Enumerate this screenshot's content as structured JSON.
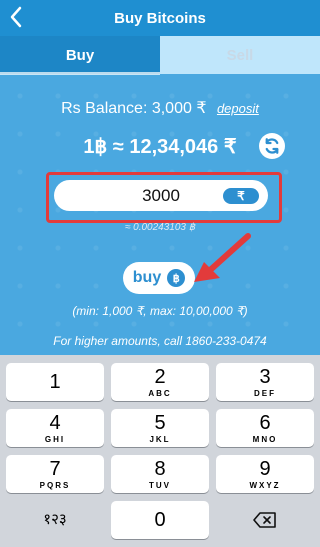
{
  "header": {
    "title": "Buy Bitcoins"
  },
  "tabs": [
    {
      "label": "Buy"
    },
    {
      "label": "Sell"
    }
  ],
  "balance": {
    "text": "Rs Balance: 3,000 ₹",
    "deposit_label": "deposit"
  },
  "rate": {
    "text": "1฿ ≈ 12,34,046 ₹"
  },
  "amount_input": {
    "value": "3000",
    "currency_label": "₹"
  },
  "btc_equivalent": "≈ 0.00243103 ฿",
  "buy_button": {
    "label": "buy",
    "icon_label": "฿"
  },
  "limits_text": "(min: 1,000 ₹, max: 10,00,000 ₹)",
  "higher_amounts_text": "For higher amounts, call 1860-233-0474",
  "keyboard": {
    "keys": [
      {
        "n": "1",
        "l": ""
      },
      {
        "n": "2",
        "l": "ABC"
      },
      {
        "n": "3",
        "l": "DEF"
      },
      {
        "n": "4",
        "l": "GHI"
      },
      {
        "n": "5",
        "l": "JKL"
      },
      {
        "n": "6",
        "l": "MNO"
      },
      {
        "n": "7",
        "l": "PQRS"
      },
      {
        "n": "8",
        "l": "TUV"
      },
      {
        "n": "9",
        "l": "WXYZ"
      },
      {
        "n": "१२३",
        "l": ""
      },
      {
        "n": "0",
        "l": ""
      },
      {
        "n": "",
        "l": ""
      }
    ]
  },
  "colors": {
    "header_bg": "#1f8fd1",
    "panel_bg": "#4aa8e0",
    "accent": "#2d8fd0",
    "highlight": "#e23b3b"
  },
  "icons": {
    "back": "chevron-left-icon",
    "refresh": "refresh-icon",
    "bitcoin": "bitcoin-icon",
    "backspace": "backspace-icon",
    "arrow": "annotation-arrow-icon"
  }
}
